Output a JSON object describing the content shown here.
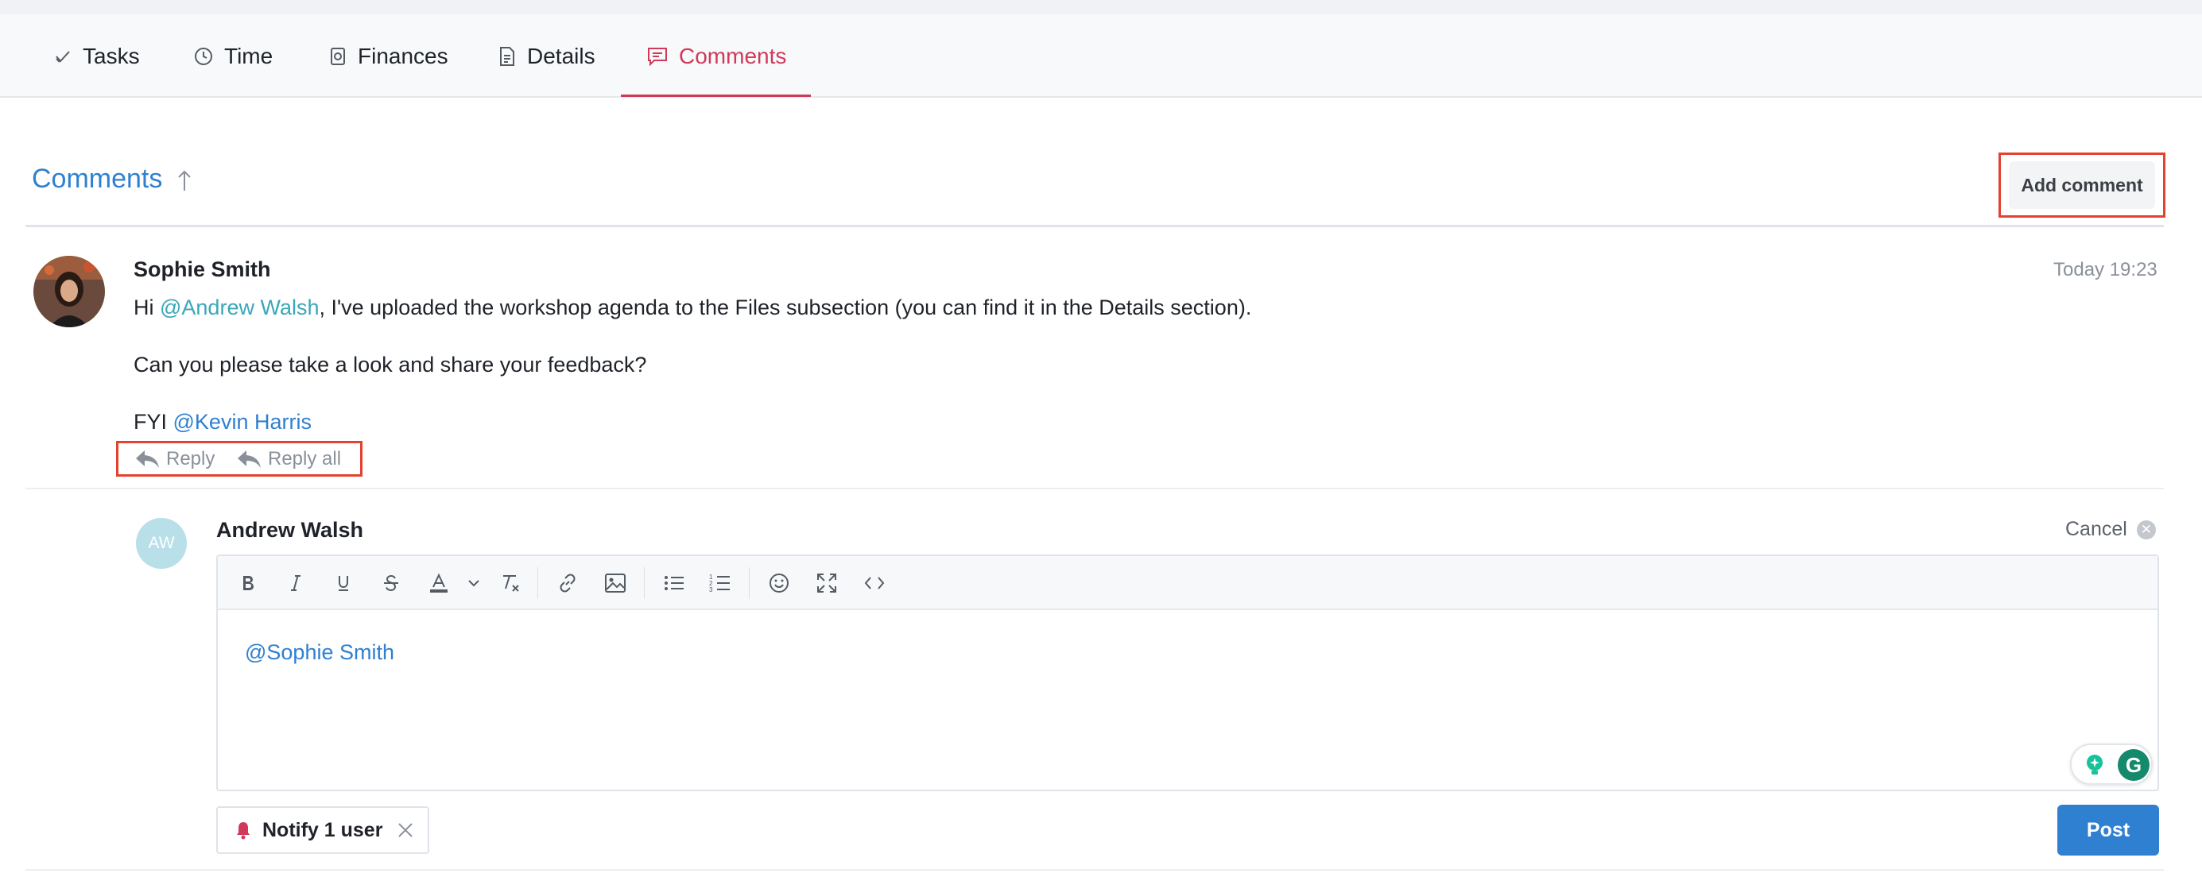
{
  "tabs": [
    {
      "label": "Tasks",
      "icon": "check-icon",
      "active": false
    },
    {
      "label": "Time",
      "icon": "clock-icon",
      "active": false
    },
    {
      "label": "Finances",
      "icon": "coins-icon",
      "active": false
    },
    {
      "label": "Details",
      "icon": "document-icon",
      "active": false
    },
    {
      "label": "Comments",
      "icon": "comment-icon",
      "active": true
    }
  ],
  "header": {
    "title": "Comments",
    "sort_icon": "arrow-up-icon",
    "add_comment_label": "Add comment"
  },
  "comment": {
    "author": "Sophie Smith",
    "timestamp": "Today 19:23",
    "line1_prefix": "Hi ",
    "line1_mention": "@Andrew Walsh",
    "line1_suffix": ", I've uploaded the workshop agenda to the Files subsection (you can find it in the Details section).",
    "line2": "Can you please take a look and share your feedback?",
    "line3_prefix": "FYI ",
    "line3_mention": "@Kevin Harris",
    "reply_label": "Reply",
    "reply_all_label": "Reply all"
  },
  "reply_editor": {
    "author": "Andrew Walsh",
    "initials": "AW",
    "cancel_label": "Cancel",
    "content": "@Sophie Smith",
    "toolbar_icons": [
      "bold-icon",
      "italic-icon",
      "underline-icon",
      "strikethrough-icon",
      "text-color-icon",
      "chevron-down-icon",
      "clear-format-icon",
      "link-icon",
      "image-icon",
      "bullet-list-icon",
      "numbered-list-icon",
      "emoji-icon",
      "fullscreen-icon",
      "code-icon"
    ],
    "notify_label": "Notify 1 user",
    "post_label": "Post"
  },
  "colors": {
    "accent_active_tab": "#d03a5a",
    "link_blue": "#2f80d0",
    "mention_teal": "#3aa7b8",
    "highlight_border": "#e4412f"
  }
}
